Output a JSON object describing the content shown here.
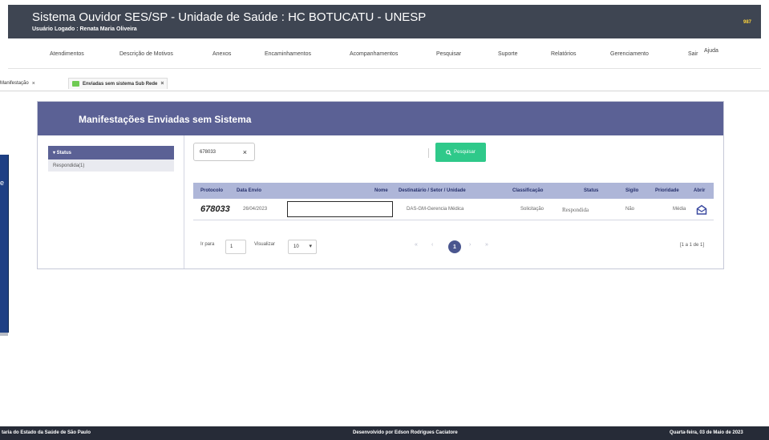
{
  "header": {
    "title": "Sistema Ouvidor SES/SP - Unidade de Saúde : HC BOTUCATU - UNESP",
    "user": "Usuário Logado : Renata Maria Oliveira",
    "corner": "987"
  },
  "menu": {
    "items": [
      "Atendimentos",
      "Descrição de Motivos",
      "Anexos",
      "Encaminhamentos",
      "Acompanhamentos",
      "Pesquisar",
      "Suporte",
      "Relatórios",
      "Gerenciamento",
      "Sair",
      "Ajuda"
    ]
  },
  "tabs": [
    {
      "label": "Manifestação"
    },
    {
      "label": "Enviadas sem sistema Sub Rede"
    }
  ],
  "tab_close": "×",
  "sidebar_glyph": "e",
  "panel": {
    "title": "Manifestações Enviadas sem Sistema",
    "filter_header": "▾ Status",
    "filter_item": "Respondida(1)"
  },
  "search": {
    "value": "678033",
    "clear": "×",
    "button_label": "Pesquisar",
    "button_icon": "search-icon"
  },
  "table": {
    "columns": [
      "Protocolo",
      "Data Envio",
      "Nome",
      "Destinatário / Setor / Unidade",
      "Classificação",
      "Status",
      "Sigilo",
      "Prioridade",
      "Abrir"
    ],
    "rows": [
      {
        "protocolo": "678033",
        "data_envio": "26/04/2023",
        "nome": "",
        "destinatario": "DAS-GM-Gerencia Médica",
        "classificacao": "Solicitação",
        "status": "Respondida",
        "sigilo": "Não",
        "prioridade": "Média",
        "abrir_icon": "open-envelope-icon"
      }
    ]
  },
  "pagination": {
    "goto_label": "Ir para",
    "goto_value": "1",
    "view_label": "Visualizar",
    "page_size": "10",
    "first": "«",
    "prev": "‹",
    "current": "1",
    "next": "›",
    "last": "»",
    "count": "[1 a 1 de 1]"
  },
  "footer": {
    "left": "taria do Estado da Saúde de São Paulo",
    "center": "Desenvolvido por Edson Rodrigues Caciatore",
    "right": "Quarta-feira, 03 de Maio de 2023"
  },
  "colors": {
    "header_bg": "#3e4552",
    "panel_header": "#5b6195",
    "table_header": "#aeb6d8",
    "search_button": "#2fc98a",
    "tab_marker": "#6fca53"
  }
}
